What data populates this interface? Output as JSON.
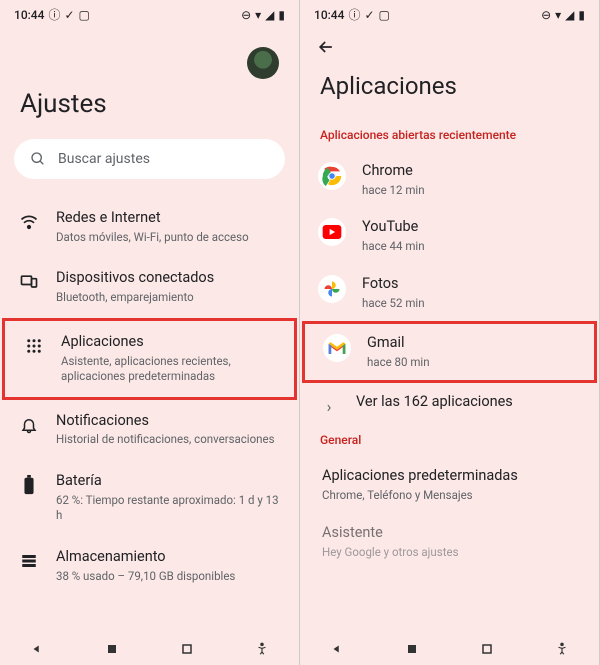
{
  "status": {
    "time": "10:44",
    "icons": [
      "ⓘ",
      "✓",
      "⬚"
    ],
    "right": [
      "⊖",
      "♡",
      "▾◢",
      "▮"
    ]
  },
  "left": {
    "title": "Ajustes",
    "search_placeholder": "Buscar ajustes",
    "items": [
      {
        "title": "Redes e Internet",
        "sub": "Datos móviles, Wi-Fi, punto de acceso",
        "icon": "wifi"
      },
      {
        "title": "Dispositivos conectados",
        "sub": "Bluetooth, emparejamiento",
        "icon": "devices"
      },
      {
        "title": "Aplicaciones",
        "sub": "Asistente, aplicaciones recientes, aplicaciones predeterminadas",
        "icon": "apps"
      },
      {
        "title": "Notificaciones",
        "sub": "Historial de notificaciones, conversaciones",
        "icon": "notifications"
      },
      {
        "title": "Batería",
        "sub": "62 %: Tiempo restante aproximado: 1 d y 13 h",
        "icon": "battery"
      },
      {
        "title": "Almacenamiento",
        "sub": "38 % usado – 79,10 GB disponibles",
        "icon": "storage"
      }
    ]
  },
  "right": {
    "title": "Aplicaciones",
    "recent_header": "Aplicaciones abiertas recientemente",
    "apps": [
      {
        "name": "Chrome",
        "sub": "hace 12 min",
        "icon": "chrome"
      },
      {
        "name": "YouTube",
        "sub": "hace 44 min",
        "icon": "youtube"
      },
      {
        "name": "Fotos",
        "sub": "hace 52 min",
        "icon": "photos"
      },
      {
        "name": "Gmail",
        "sub": "hace 80 min",
        "icon": "gmail"
      }
    ],
    "see_all": "Ver las 162 aplicaciones",
    "general_header": "General",
    "default_apps": {
      "title": "Aplicaciones predeterminadas",
      "sub": "Chrome, Teléfono y Mensajes"
    },
    "assistant": {
      "title": "Asistente",
      "sub": "Hey Google y otros ajustes"
    }
  }
}
